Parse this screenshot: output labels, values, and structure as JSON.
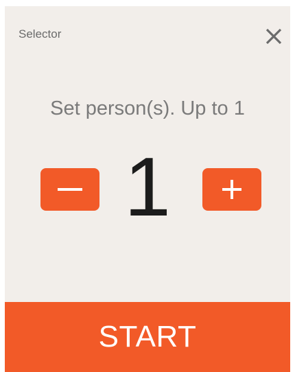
{
  "dialog": {
    "title": "Selector",
    "close_icon": "close-icon"
  },
  "prompt": "Set person(s). Up to 1",
  "stepper": {
    "value": "1",
    "minus_icon": "minus-icon",
    "plus_icon": "plus-icon"
  },
  "start_label": "START",
  "colors": {
    "accent": "#f25a28",
    "panel_background": "#f2eeea",
    "text_muted": "#7a7a7a",
    "text_value": "#1c1c1c"
  }
}
